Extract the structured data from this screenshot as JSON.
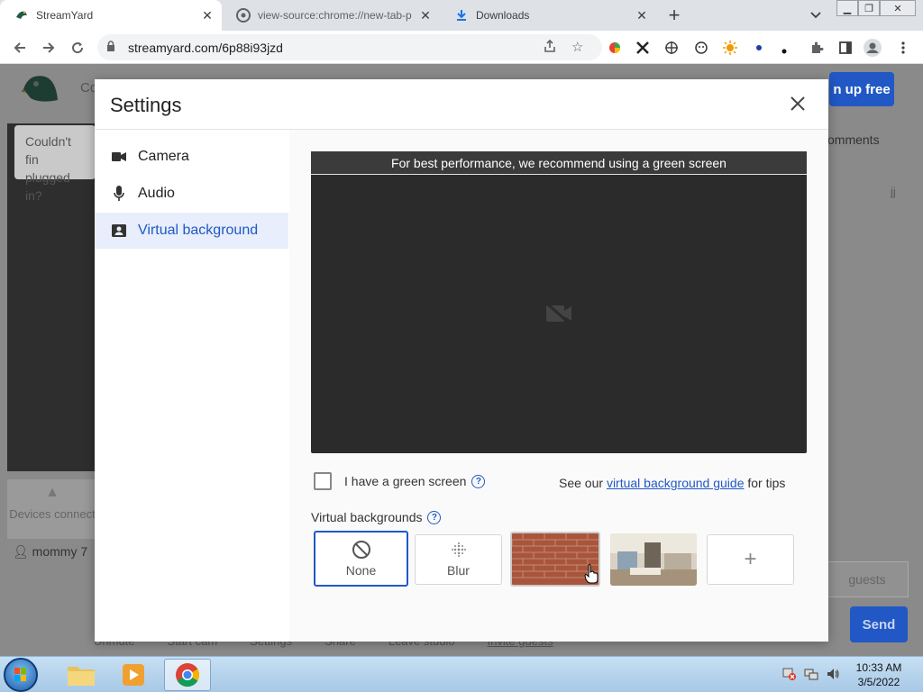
{
  "browser": {
    "tabs": [
      {
        "title": "StreamYard",
        "active": true,
        "icon": "streamyard-icon"
      },
      {
        "title": "view-source:chrome://new-tab-p",
        "active": false,
        "icon": "chrome-icon"
      },
      {
        "title": "Downloads",
        "active": false,
        "icon": "download-icon"
      }
    ],
    "url": "streamyard.com/6p88i93jzd"
  },
  "background_page": {
    "partial_header": "Co",
    "warning": "Couldn't fin plugged in?",
    "signup_label": "n up free",
    "comments_label": "omments",
    "devices_label": "Devices connect",
    "participant": "mommy 7",
    "guests_placeholder": "guests",
    "send_label": "Send",
    "bottom_controls": [
      "Unmute",
      "Start cam",
      "Settings",
      "Share",
      "Leave studio",
      "Invite guests"
    ]
  },
  "settings": {
    "title": "Settings",
    "menu": [
      {
        "label": "Camera",
        "icon": "video-camera-icon",
        "active": false
      },
      {
        "label": "Audio",
        "icon": "microphone-icon",
        "active": false
      },
      {
        "label": "Virtual background",
        "icon": "portrait-icon",
        "active": true
      }
    ],
    "preview_banner": "For best performance, we recommend using a green screen",
    "green_screen_label": "I have a green screen",
    "green_screen_checked": false,
    "tips_prefix": "See our",
    "tips_link": "virtual background guide",
    "tips_suffix": "for tips",
    "virtual_backgrounds_label": "Virtual backgrounds",
    "options": [
      {
        "label": "None",
        "selected": true,
        "icon": "no-entry-icon"
      },
      {
        "label": "Blur",
        "selected": false,
        "icon": "blur-icon"
      },
      {
        "label": "",
        "selected": false,
        "icon": "brick-wall-image"
      },
      {
        "label": "",
        "selected": false,
        "icon": "living-room-image"
      },
      {
        "label": "+",
        "selected": false,
        "icon": "add-icon"
      }
    ]
  },
  "taskbar": {
    "time": "10:33 AM",
    "date": "3/5/2022"
  },
  "colors": {
    "accent": "#2158c6",
    "modal_bg": "#ffffff",
    "overlay": "#8a8a8a"
  }
}
